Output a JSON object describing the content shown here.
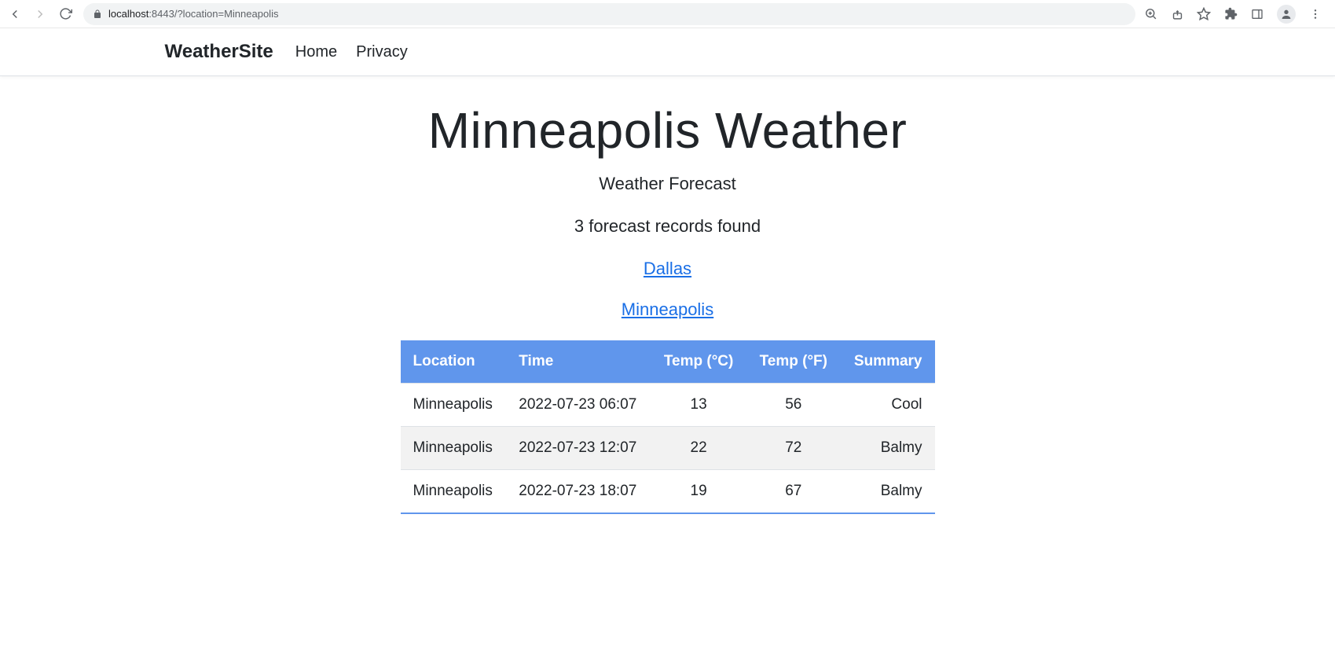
{
  "browser": {
    "url_host": "localhost",
    "url_port_path": ":8443/?location=Minneapolis"
  },
  "navbar": {
    "brand": "WeatherSite",
    "links": [
      {
        "label": "Home"
      },
      {
        "label": "Privacy"
      }
    ]
  },
  "page": {
    "title": "Minneapolis Weather",
    "subtitle": "Weather Forecast",
    "records_found": "3 forecast records found",
    "city_links": [
      {
        "label": "Dallas"
      },
      {
        "label": "Minneapolis"
      }
    ]
  },
  "table": {
    "headers": {
      "location": "Location",
      "time": "Time",
      "temp_c": "Temp (°C)",
      "temp_f": "Temp (°F)",
      "summary": "Summary"
    },
    "rows": [
      {
        "location": "Minneapolis",
        "time": "2022-07-23 06:07",
        "temp_c": "13",
        "temp_f": "56",
        "summary": "Cool"
      },
      {
        "location": "Minneapolis",
        "time": "2022-07-23 12:07",
        "temp_c": "22",
        "temp_f": "72",
        "summary": "Balmy"
      },
      {
        "location": "Minneapolis",
        "time": "2022-07-23 18:07",
        "temp_c": "19",
        "temp_f": "67",
        "summary": "Balmy"
      }
    ]
  }
}
